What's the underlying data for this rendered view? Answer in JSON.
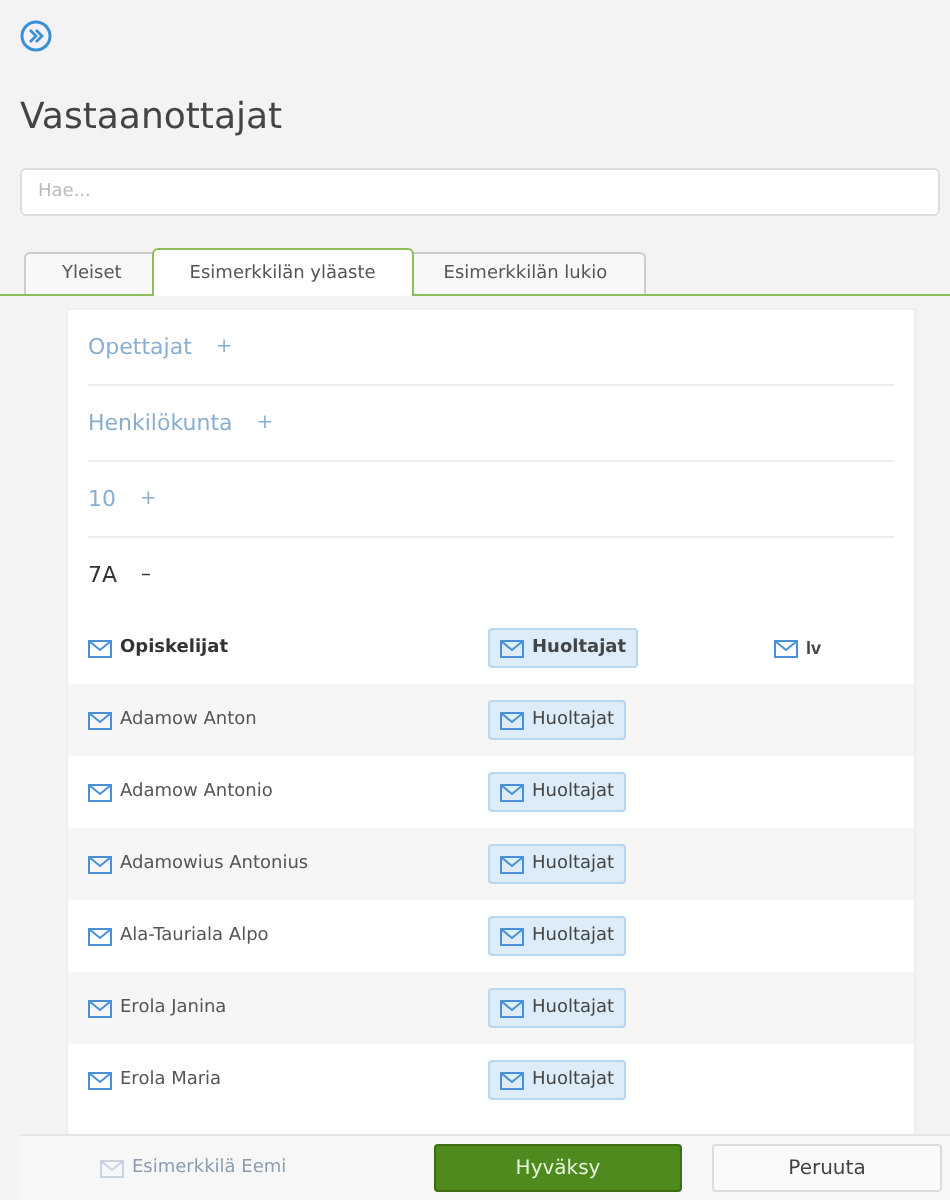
{
  "title": "Vastaanottajat",
  "search": {
    "placeholder": "Hae..."
  },
  "tabs": [
    {
      "label": "Yleiset",
      "selected": false
    },
    {
      "label": "Esimerkkilän yläaste",
      "selected": true
    },
    {
      "label": "Esimerkkilän lukio",
      "selected": false
    }
  ],
  "groups": [
    {
      "label": "Opettajat",
      "expanded": false
    },
    {
      "label": "Henkilökunta",
      "expanded": false
    },
    {
      "label": "10",
      "expanded": false
    },
    {
      "label": "7A",
      "expanded": true,
      "toggle": "–"
    }
  ],
  "collapsed_toggle": "+",
  "rows": [
    {
      "kind": "header",
      "name": "Opiskelijat",
      "guardians": "Huoltajat",
      "extra": "lv"
    },
    {
      "kind": "student",
      "name": "Adamow Anton",
      "guardians": "Huoltajat"
    },
    {
      "kind": "student",
      "name": "Adamow Antonio",
      "guardians": "Huoltajat"
    },
    {
      "kind": "student",
      "name": "Adamowius Antonius",
      "guardians": "Huoltajat"
    },
    {
      "kind": "student",
      "name": "Ala-Tauriala Alpo",
      "guardians": "Huoltajat"
    },
    {
      "kind": "student",
      "name": "Erola Janina",
      "guardians": "Huoltajat"
    },
    {
      "kind": "student",
      "name": "Erola Maria",
      "guardians": "Huoltajat"
    }
  ],
  "footer": {
    "partial_row": "Esimerkkilä Eemi",
    "buttons": [
      {
        "label": "Hyväksy",
        "kind": "primary"
      },
      {
        "label": "Peruuta",
        "kind": "secondary"
      }
    ]
  }
}
